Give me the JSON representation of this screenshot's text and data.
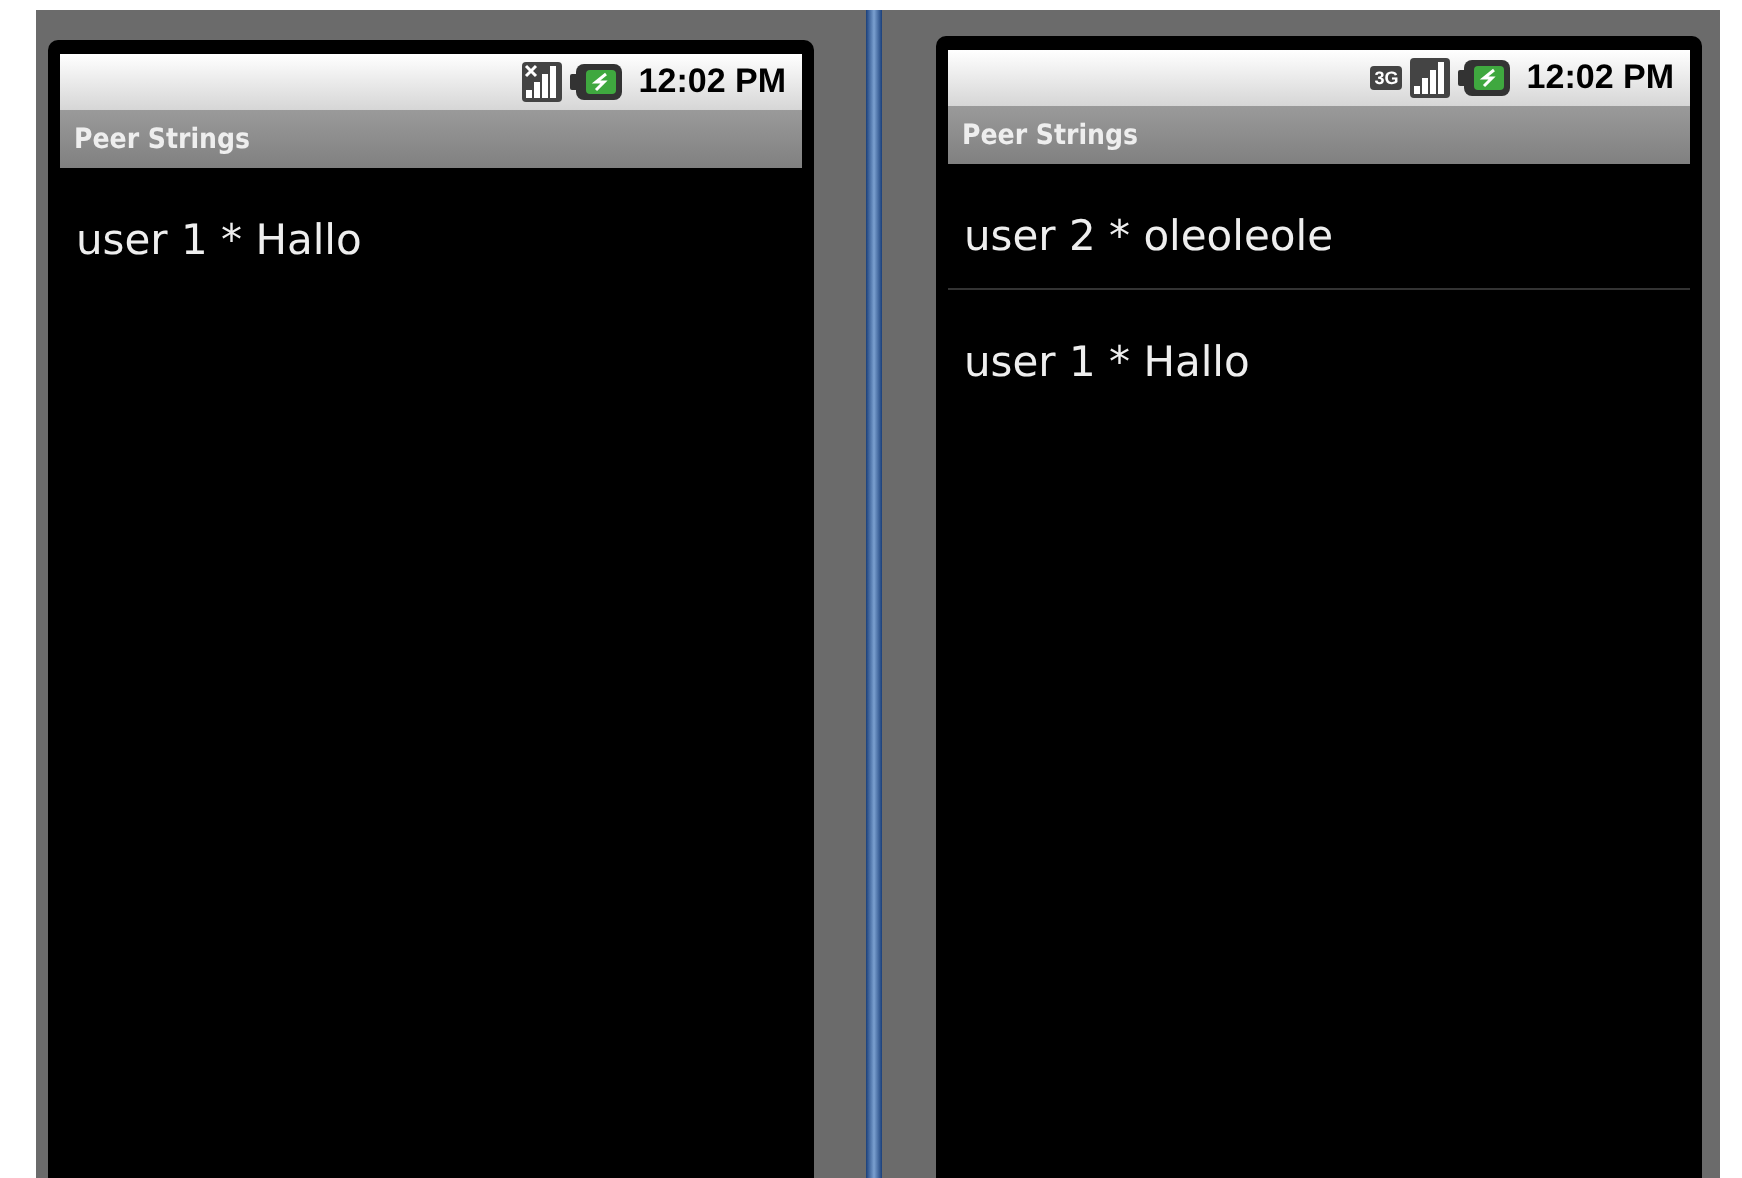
{
  "phones": [
    {
      "status_bar": {
        "icons": [
          {
            "kind": "signal-none"
          },
          {
            "kind": "battery"
          }
        ],
        "time": "12:02 PM"
      },
      "title": "Peer Strings",
      "messages": [
        "user 1 * Hallo"
      ]
    },
    {
      "status_bar": {
        "icons": [
          {
            "kind": "data",
            "text": "3G"
          },
          {
            "kind": "signal"
          },
          {
            "kind": "battery"
          }
        ],
        "time": "12:02 PM"
      },
      "title": "Peer Strings",
      "messages": [
        "user 2 * oleoleole",
        "user 1 * Hallo"
      ]
    }
  ]
}
